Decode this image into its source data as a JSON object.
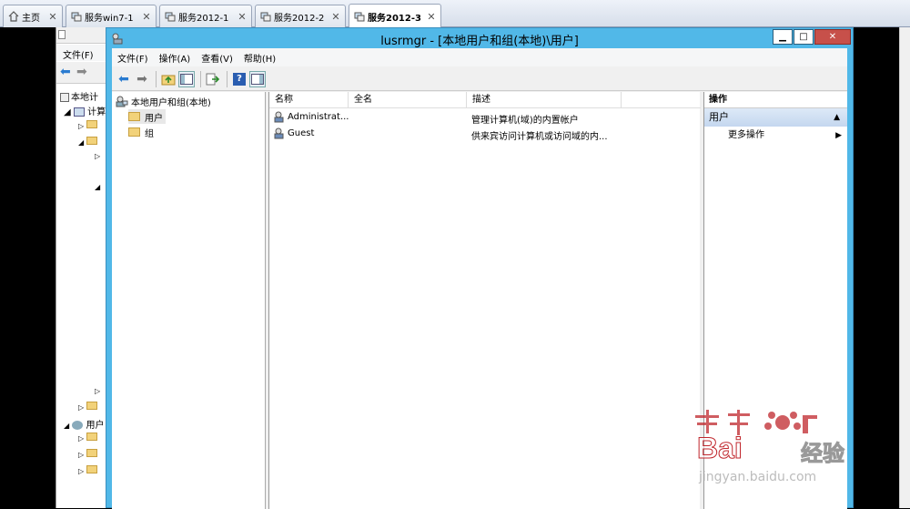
{
  "tabs": [
    {
      "label": "主页",
      "icon": "home-icon"
    },
    {
      "label": "服务win7-1",
      "icon": "server-icon"
    },
    {
      "label": "服务2012-1",
      "icon": "server-icon"
    },
    {
      "label": "服务2012-2",
      "icon": "server-icon"
    },
    {
      "label": "服务2012-3",
      "icon": "server-icon",
      "active": true
    }
  ],
  "bg_window": {
    "menu": "文件(F)",
    "tree_root": "本地计",
    "tree_item1": "计算",
    "tree_item2": "用户"
  },
  "window": {
    "title": "lusrmgr - [本地用户和组(本地)\\用户]",
    "menu": [
      "文件(F)",
      "操作(A)",
      "查看(V)",
      "帮助(H)"
    ]
  },
  "tree": {
    "root": "本地用户和组(本地)",
    "items": [
      "用户",
      "组"
    ]
  },
  "list": {
    "columns": [
      "名称",
      "全名",
      "描述"
    ],
    "rows": [
      {
        "name": "Administrat...",
        "fullname": "",
        "desc": "管理计算机(域)的内置帐户"
      },
      {
        "name": "Guest",
        "fullname": "",
        "desc": "供来宾访问计算机或访问域的内..."
      }
    ]
  },
  "actions": {
    "header": "操作",
    "section": "用户",
    "more": "更多操作"
  },
  "watermark": {
    "text1": "Bai",
    "text2": "经验",
    "url": "jingyan.baidu.com"
  },
  "colors": {
    "window_frame": "#51b8e8",
    "tab_bg": "#dfe5ee",
    "selection": "#c4d7ef"
  }
}
